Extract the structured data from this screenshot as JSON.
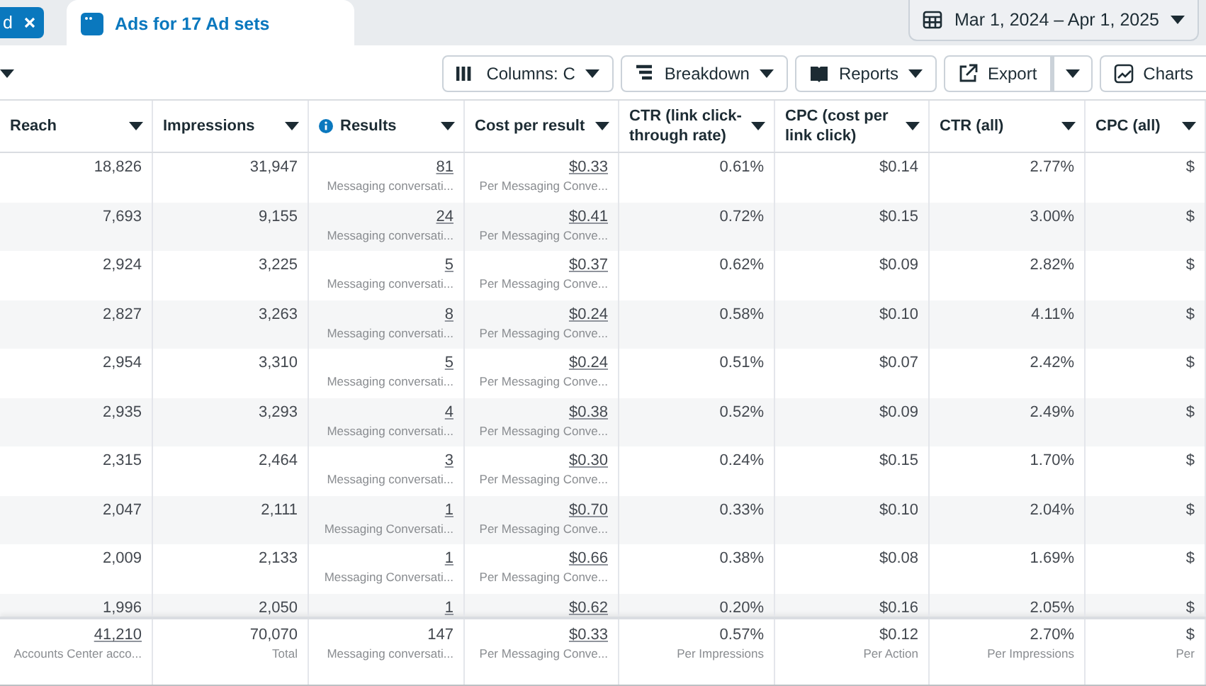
{
  "tabs": [
    {
      "label": "d",
      "selected": false,
      "closable": true
    },
    {
      "label": "Ads for 17 Ad sets",
      "selected": true,
      "closable": false
    }
  ],
  "date_range": "Mar 1, 2024 – Apr 1, 2025",
  "toolbar": [
    {
      "kind": "menu",
      "label": "Columns: C"
    },
    {
      "kind": "menu",
      "label": "Breakdown"
    },
    {
      "kind": "menu",
      "label": "Reports"
    },
    {
      "kind": "split",
      "label": "Export"
    },
    {
      "kind": "plain",
      "label": "Charts"
    }
  ],
  "table": {
    "columns": [
      {
        "label": "Reach",
        "info": false
      },
      {
        "label": "Impressions",
        "info": false
      },
      {
        "label": "Results",
        "info": true
      },
      {
        "label": "Cost per result",
        "info": false
      },
      {
        "label": "CTR (link click-through rate)",
        "info": false
      },
      {
        "label": "CPC (cost per link click)",
        "info": false
      },
      {
        "label": "CTR (all)",
        "info": false
      },
      {
        "label": "CPC (all)",
        "info": false
      }
    ],
    "rows": [
      {
        "cells": [
          {
            "value": "18,826"
          },
          {
            "value": "31,947"
          },
          {
            "value": "81",
            "sub": "Messaging conversati...",
            "link": true
          },
          {
            "value": "$0.33",
            "sub": "Per Messaging Conve...",
            "link": true
          },
          {
            "value": "0.61%"
          },
          {
            "value": "$0.14"
          },
          {
            "value": "2.77%"
          },
          {
            "value": "$"
          }
        ]
      },
      {
        "cells": [
          {
            "value": "7,693"
          },
          {
            "value": "9,155"
          },
          {
            "value": "24",
            "sub": "Messaging conversati...",
            "link": true
          },
          {
            "value": "$0.41",
            "sub": "Per Messaging Conve...",
            "link": true
          },
          {
            "value": "0.72%"
          },
          {
            "value": "$0.15"
          },
          {
            "value": "3.00%"
          },
          {
            "value": "$"
          }
        ]
      },
      {
        "cells": [
          {
            "value": "2,924"
          },
          {
            "value": "3,225"
          },
          {
            "value": "5",
            "sub": "Messaging conversati...",
            "link": true
          },
          {
            "value": "$0.37",
            "sub": "Per Messaging Conve...",
            "link": true
          },
          {
            "value": "0.62%"
          },
          {
            "value": "$0.09"
          },
          {
            "value": "2.82%"
          },
          {
            "value": "$"
          }
        ]
      },
      {
        "cells": [
          {
            "value": "2,827"
          },
          {
            "value": "3,263"
          },
          {
            "value": "8",
            "sub": "Messaging conversati...",
            "link": true
          },
          {
            "value": "$0.24",
            "sub": "Per Messaging Conve...",
            "link": true
          },
          {
            "value": "0.58%"
          },
          {
            "value": "$0.10"
          },
          {
            "value": "4.11%"
          },
          {
            "value": "$"
          }
        ]
      },
      {
        "cells": [
          {
            "value": "2,954"
          },
          {
            "value": "3,310"
          },
          {
            "value": "5",
            "sub": "Messaging conversati...",
            "link": true
          },
          {
            "value": "$0.24",
            "sub": "Per Messaging Conve...",
            "link": true
          },
          {
            "value": "0.51%"
          },
          {
            "value": "$0.07"
          },
          {
            "value": "2.42%"
          },
          {
            "value": "$"
          }
        ]
      },
      {
        "cells": [
          {
            "value": "2,935"
          },
          {
            "value": "3,293"
          },
          {
            "value": "4",
            "sub": "Messaging conversati...",
            "link": true
          },
          {
            "value": "$0.38",
            "sub": "Per Messaging Conve...",
            "link": true
          },
          {
            "value": "0.52%"
          },
          {
            "value": "$0.09"
          },
          {
            "value": "2.49%"
          },
          {
            "value": "$"
          }
        ]
      },
      {
        "cells": [
          {
            "value": "2,315"
          },
          {
            "value": "2,464"
          },
          {
            "value": "3",
            "sub": "Messaging conversati...",
            "link": true
          },
          {
            "value": "$0.30",
            "sub": "Per Messaging Conve...",
            "link": true
          },
          {
            "value": "0.24%"
          },
          {
            "value": "$0.15"
          },
          {
            "value": "1.70%"
          },
          {
            "value": "$"
          }
        ]
      },
      {
        "cells": [
          {
            "value": "2,047"
          },
          {
            "value": "2,111"
          },
          {
            "value": "1",
            "sub": "Messaging Conversati...",
            "link": true
          },
          {
            "value": "$0.70",
            "sub": "Per Messaging Conve...",
            "link": true
          },
          {
            "value": "0.33%"
          },
          {
            "value": "$0.10"
          },
          {
            "value": "2.04%"
          },
          {
            "value": "$"
          }
        ]
      },
      {
        "cells": [
          {
            "value": "2,009"
          },
          {
            "value": "2,133"
          },
          {
            "value": "1",
            "sub": "Messaging Conversati...",
            "link": true
          },
          {
            "value": "$0.66",
            "sub": "Per Messaging Conve...",
            "link": true
          },
          {
            "value": "0.38%"
          },
          {
            "value": "$0.08"
          },
          {
            "value": "1.69%"
          },
          {
            "value": "$"
          }
        ]
      },
      {
        "cells": [
          {
            "value": "1,996"
          },
          {
            "value": "2,050"
          },
          {
            "value": "1",
            "link": true
          },
          {
            "value": "$0.62",
            "link": true
          },
          {
            "value": "0.20%"
          },
          {
            "value": "$0.16"
          },
          {
            "value": "2.05%"
          },
          {
            "value": "$"
          }
        ]
      }
    ],
    "totals": [
      {
        "value": "41,210",
        "sub": "Accounts Center acco...",
        "link": true
      },
      {
        "value": "70,070",
        "sub": "Total"
      },
      {
        "value": "147",
        "sub": "Messaging conversati..."
      },
      {
        "value": "$0.33",
        "sub": "Per Messaging Conve...",
        "link": true
      },
      {
        "value": "0.57%",
        "sub": "Per Impressions"
      },
      {
        "value": "$0.12",
        "sub": "Per Action"
      },
      {
        "value": "2.70%",
        "sub": "Per Impressions"
      },
      {
        "value": "$",
        "sub": "Per"
      }
    ]
  }
}
